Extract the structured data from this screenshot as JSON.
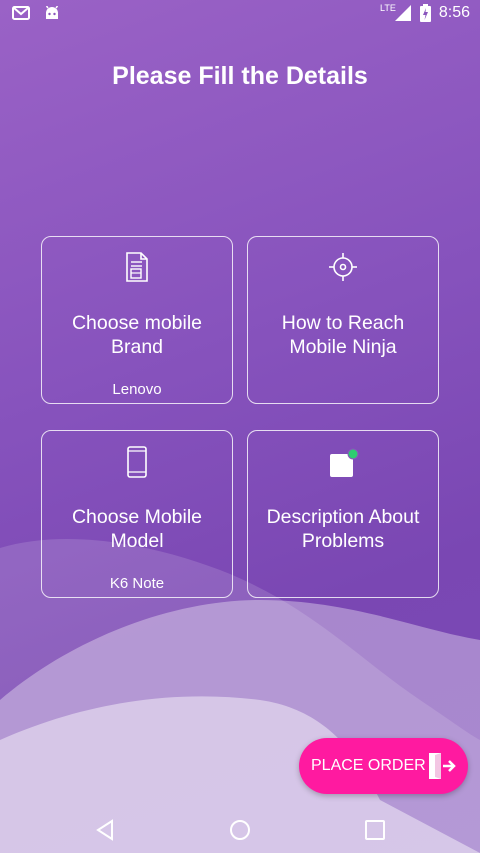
{
  "status": {
    "time": "8:56",
    "network": "LTE",
    "left_icons": [
      "gmail-icon",
      "android-icon"
    ]
  },
  "title": "Please Fill the Details",
  "cards": [
    {
      "label": "Choose mobile Brand",
      "value": "Lenovo",
      "icon": "document-icon"
    },
    {
      "label": "How to Reach Mobile Ninja",
      "value": "",
      "icon": "target-icon"
    },
    {
      "label": "Choose Mobile Model",
      "value": "K6 Note",
      "icon": "phone-icon"
    },
    {
      "label": "Description About Problems",
      "value": "",
      "icon": "note-icon"
    }
  ],
  "place_order": {
    "label": "PLACE ORDER",
    "icon": "exit-icon"
  },
  "colors": {
    "button": "#ff1aa0",
    "background_top": "#9a62c6",
    "background_bottom": "#7a47b3",
    "dot": "#2ecc71"
  },
  "navbar": [
    "back-icon",
    "home-icon",
    "recents-icon"
  ]
}
